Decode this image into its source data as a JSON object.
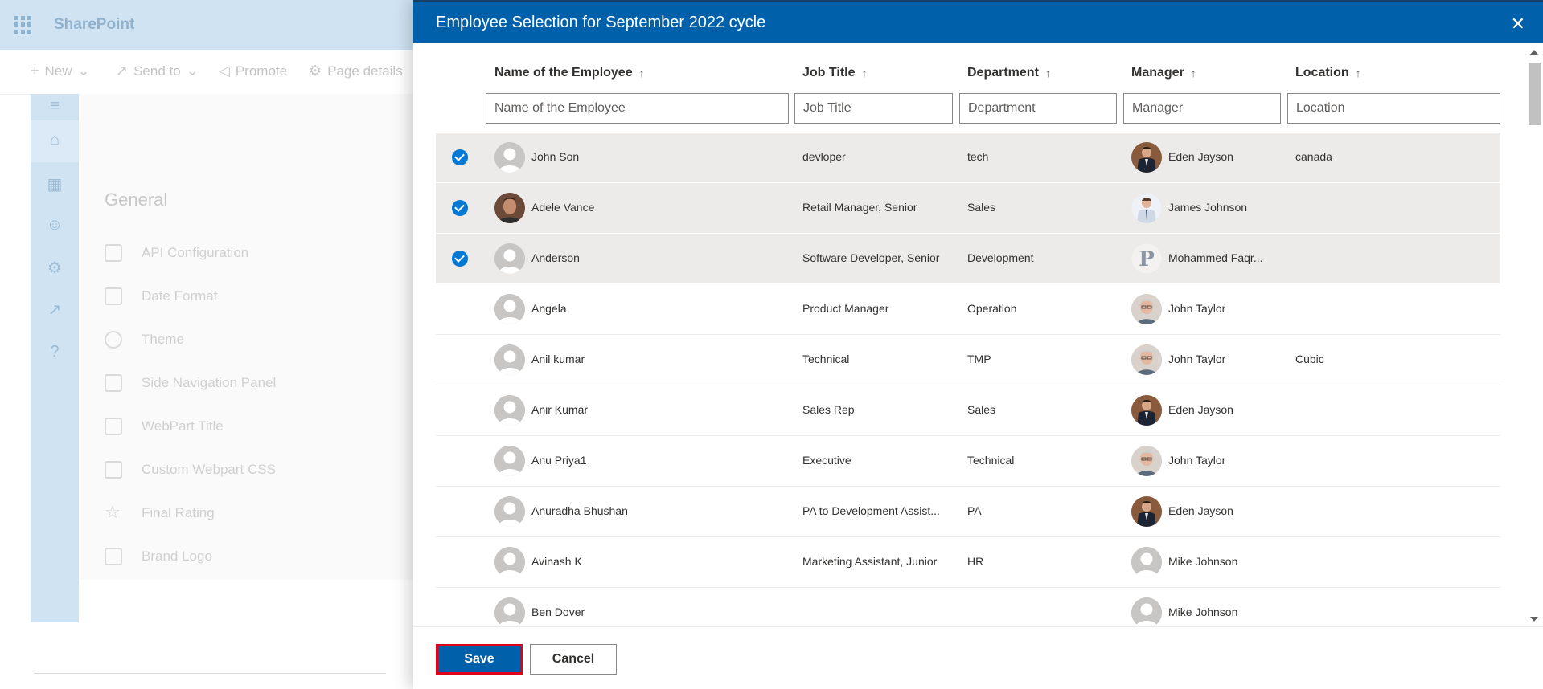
{
  "background": {
    "brand": "SharePoint",
    "commands": [
      "New",
      "Send to",
      "Promote",
      "Page details"
    ],
    "section_title": "General",
    "settings_items": [
      "API Configuration",
      "Date Format",
      "Theme",
      "Side Navigation Panel",
      "WebPart Title",
      "Custom Webpart CSS",
      "Final Rating",
      "Brand Logo"
    ]
  },
  "dialog": {
    "title": "Employee Selection for September 2022 cycle",
    "columns": [
      {
        "label": "Name of the Employee",
        "placeholder": "Name of the Employee"
      },
      {
        "label": "Job Title",
        "placeholder": "Job Title"
      },
      {
        "label": "Department",
        "placeholder": "Department"
      },
      {
        "label": "Manager",
        "placeholder": "Manager"
      },
      {
        "label": "Location",
        "placeholder": "Location"
      }
    ],
    "rows": [
      {
        "selected": true,
        "name": "John Son",
        "avatar": "default",
        "job": "devloper",
        "dept": "tech",
        "manager": "Eden Jayson",
        "mgr_avatar": "suit",
        "location": "canada"
      },
      {
        "selected": true,
        "name": "Adele Vance",
        "avatar": "photo",
        "job": "Retail Manager, Senior",
        "dept": "Sales",
        "manager": "James Johnson",
        "mgr_avatar": "shirt",
        "location": ""
      },
      {
        "selected": true,
        "name": "Anderson",
        "avatar": "default",
        "job": "Software Developer, Senior",
        "dept": "Development",
        "manager": "Mohammed Faqr...",
        "mgr_avatar": "letter",
        "location": ""
      },
      {
        "selected": false,
        "name": "Angela",
        "avatar": "default",
        "job": "Product Manager",
        "dept": "Operation",
        "manager": "John Taylor",
        "mgr_avatar": "older",
        "location": ""
      },
      {
        "selected": false,
        "name": "Anil kumar",
        "avatar": "default",
        "job": "Technical",
        "dept": "TMP",
        "manager": "John Taylor",
        "mgr_avatar": "older",
        "location": "Cubic"
      },
      {
        "selected": false,
        "name": "Anir Kumar",
        "avatar": "default",
        "job": "Sales Rep",
        "dept": "Sales",
        "manager": "Eden Jayson",
        "mgr_avatar": "suit",
        "location": ""
      },
      {
        "selected": false,
        "name": "Anu Priya1",
        "avatar": "default",
        "job": "Executive",
        "dept": "Technical",
        "manager": "John Taylor",
        "mgr_avatar": "older",
        "location": ""
      },
      {
        "selected": false,
        "name": "Anuradha Bhushan",
        "avatar": "default",
        "job": "PA to Development Assist...",
        "dept": "PA",
        "manager": "Eden Jayson",
        "mgr_avatar": "suit",
        "location": ""
      },
      {
        "selected": false,
        "name": "Avinash K",
        "avatar": "default",
        "job": "Marketing Assistant, Junior",
        "dept": "HR",
        "manager": "Mike Johnson",
        "mgr_avatar": "default",
        "location": ""
      },
      {
        "selected": false,
        "name": "Ben Dover",
        "avatar": "default",
        "job": "",
        "dept": "",
        "manager": "Mike Johnson",
        "mgr_avatar": "default",
        "location": ""
      }
    ],
    "save_label": "Save",
    "cancel_label": "Cancel",
    "close_glyph": "✕"
  }
}
